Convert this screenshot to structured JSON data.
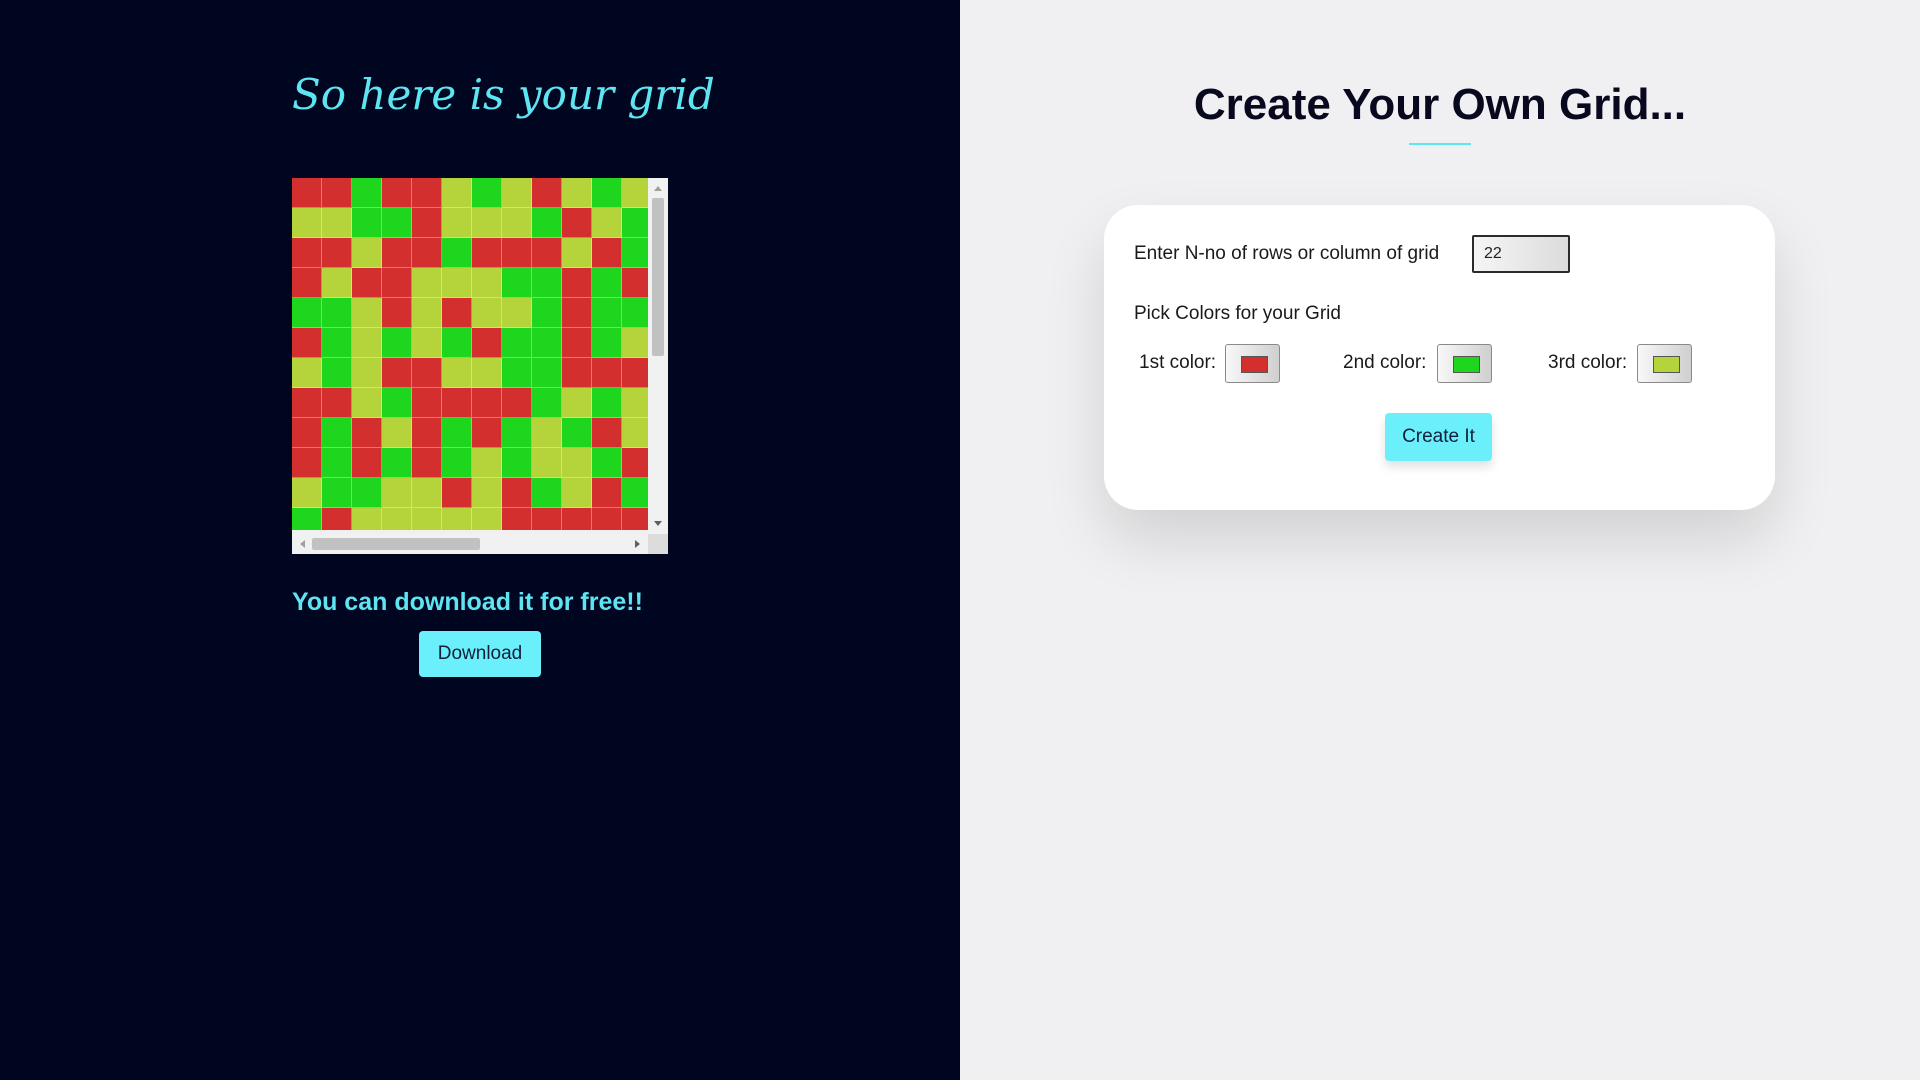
{
  "left": {
    "heading": "So here is your grid",
    "download_text": "You can download it for free!!",
    "download_label": "Download"
  },
  "right": {
    "title": "Create Your Own Grid...",
    "n_label": "Enter N-no of rows or column of grid",
    "n_value": "22",
    "pick_label": "Pick Colors for your Grid",
    "colors": [
      {
        "label": "1st color:",
        "value": "#d32f2f"
      },
      {
        "label": "2nd color:",
        "value": "#1ed61e"
      },
      {
        "label": "3rd color:",
        "value": "#b5d43c"
      }
    ],
    "create_label": "Create It"
  },
  "grid": {
    "n": 22,
    "palette": [
      "#d32f2f",
      "#1ed61e",
      "#b5d43c"
    ],
    "cells": [
      [
        0,
        0,
        1,
        0,
        0,
        2,
        1,
        2,
        0,
        2,
        1,
        2
      ],
      [
        2,
        2,
        1,
        1,
        0,
        2,
        2,
        2,
        1,
        0,
        2,
        1
      ],
      [
        0,
        0,
        2,
        0,
        0,
        1,
        0,
        0,
        0,
        2,
        0,
        1
      ],
      [
        0,
        2,
        0,
        0,
        2,
        2,
        2,
        1,
        1,
        0,
        1,
        0
      ],
      [
        1,
        1,
        2,
        0,
        2,
        0,
        2,
        2,
        1,
        0,
        1,
        1
      ],
      [
        0,
        1,
        2,
        1,
        2,
        1,
        0,
        1,
        1,
        0,
        1,
        2
      ],
      [
        2,
        1,
        2,
        0,
        0,
        2,
        2,
        1,
        1,
        0,
        0,
        0
      ],
      [
        0,
        0,
        2,
        1,
        0,
        0,
        0,
        0,
        1,
        2,
        1,
        2
      ],
      [
        0,
        1,
        0,
        2,
        0,
        1,
        0,
        1,
        2,
        1,
        0,
        2
      ],
      [
        0,
        1,
        0,
        1,
        0,
        1,
        2,
        1,
        2,
        2,
        1,
        0
      ],
      [
        2,
        1,
        1,
        2,
        2,
        0,
        2,
        0,
        1,
        2,
        0,
        1
      ],
      [
        1,
        0,
        2,
        2,
        2,
        2,
        2,
        0,
        0,
        0,
        0,
        0
      ]
    ]
  }
}
